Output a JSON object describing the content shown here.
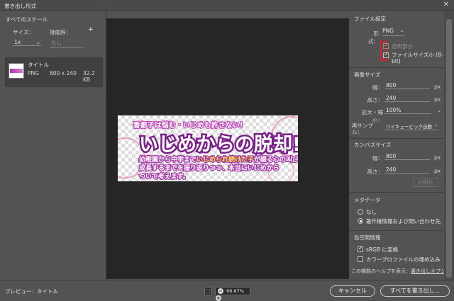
{
  "window": {
    "title": "書き出し形式"
  },
  "left_panel": {
    "header": "すべてのスケール",
    "size_label": "サイズ：",
    "suffix_label": "接尾辞：",
    "add_symbol": "+",
    "scale_value": "1x",
    "suffix_placeholder": "なし",
    "asset": {
      "name": "タイトル",
      "format": "PNG",
      "dimensions": "800 x 240",
      "filesize": "32.2 KB"
    }
  },
  "preview_image": {
    "line1": "香都子は悩む・いじめも許さない！",
    "line2": "いじめからの脱却!!",
    "line3_a": "幼稚園から中学まで",
    "line3_highlight": "いじめられ続けた子",
    "line3_b": "が綴る心の叫び",
    "line4": "成長するまでを振り返りつつ、本当にいじめから",
    "line5": "ついて考えます。"
  },
  "right_panel": {
    "file_settings": {
      "header": "ファイル設定",
      "format_label": "形式：",
      "format_value": "PNG",
      "transparency_label": "透明部分",
      "transparency_checked": true,
      "smaller_file_label": "ファイルサイズ小 (8-bit)",
      "smaller_file_checked": true
    },
    "image_size": {
      "header": "画像サイズ",
      "width_label": "幅：",
      "width_value": "800",
      "height_label": "高さ：",
      "height_value": "240",
      "unit": "px",
      "scale_label": "拡大・縮小：",
      "scale_value": "100%",
      "resample_label": "再サンプル：",
      "resample_value": "バイキュービック自動"
    },
    "canvas_size": {
      "header": "カンバスサイズ",
      "width_label": "幅：",
      "width_value": "800",
      "height_label": "高さ：",
      "height_value": "240",
      "unit": "px",
      "reset_label": "初期化"
    },
    "metadata": {
      "header": "メタデータ",
      "option_none": "なし",
      "option_copyright": "著作権情報および問い合わせ先",
      "selected": "option_copyright"
    },
    "color_space": {
      "header": "色空間情報",
      "srgb_label": "sRGB に変換",
      "srgb_checked": true,
      "embed_label": "カラープロファイルの埋め込み",
      "embed_checked": false
    },
    "help_text": "この機能のヘルプを表示：",
    "help_link": "書き出しオプション"
  },
  "footer": {
    "preview_label": "プレビュー：タイトル",
    "zoom_value": "66.67%",
    "cancel_label": "キャンセル",
    "export_all_label": "すべてを書き出し..."
  },
  "colors": {
    "dialog_bg": "#535353",
    "canvas_bg": "#262626",
    "highlight_box": "#e21f26",
    "link": "#d6d6d6"
  }
}
